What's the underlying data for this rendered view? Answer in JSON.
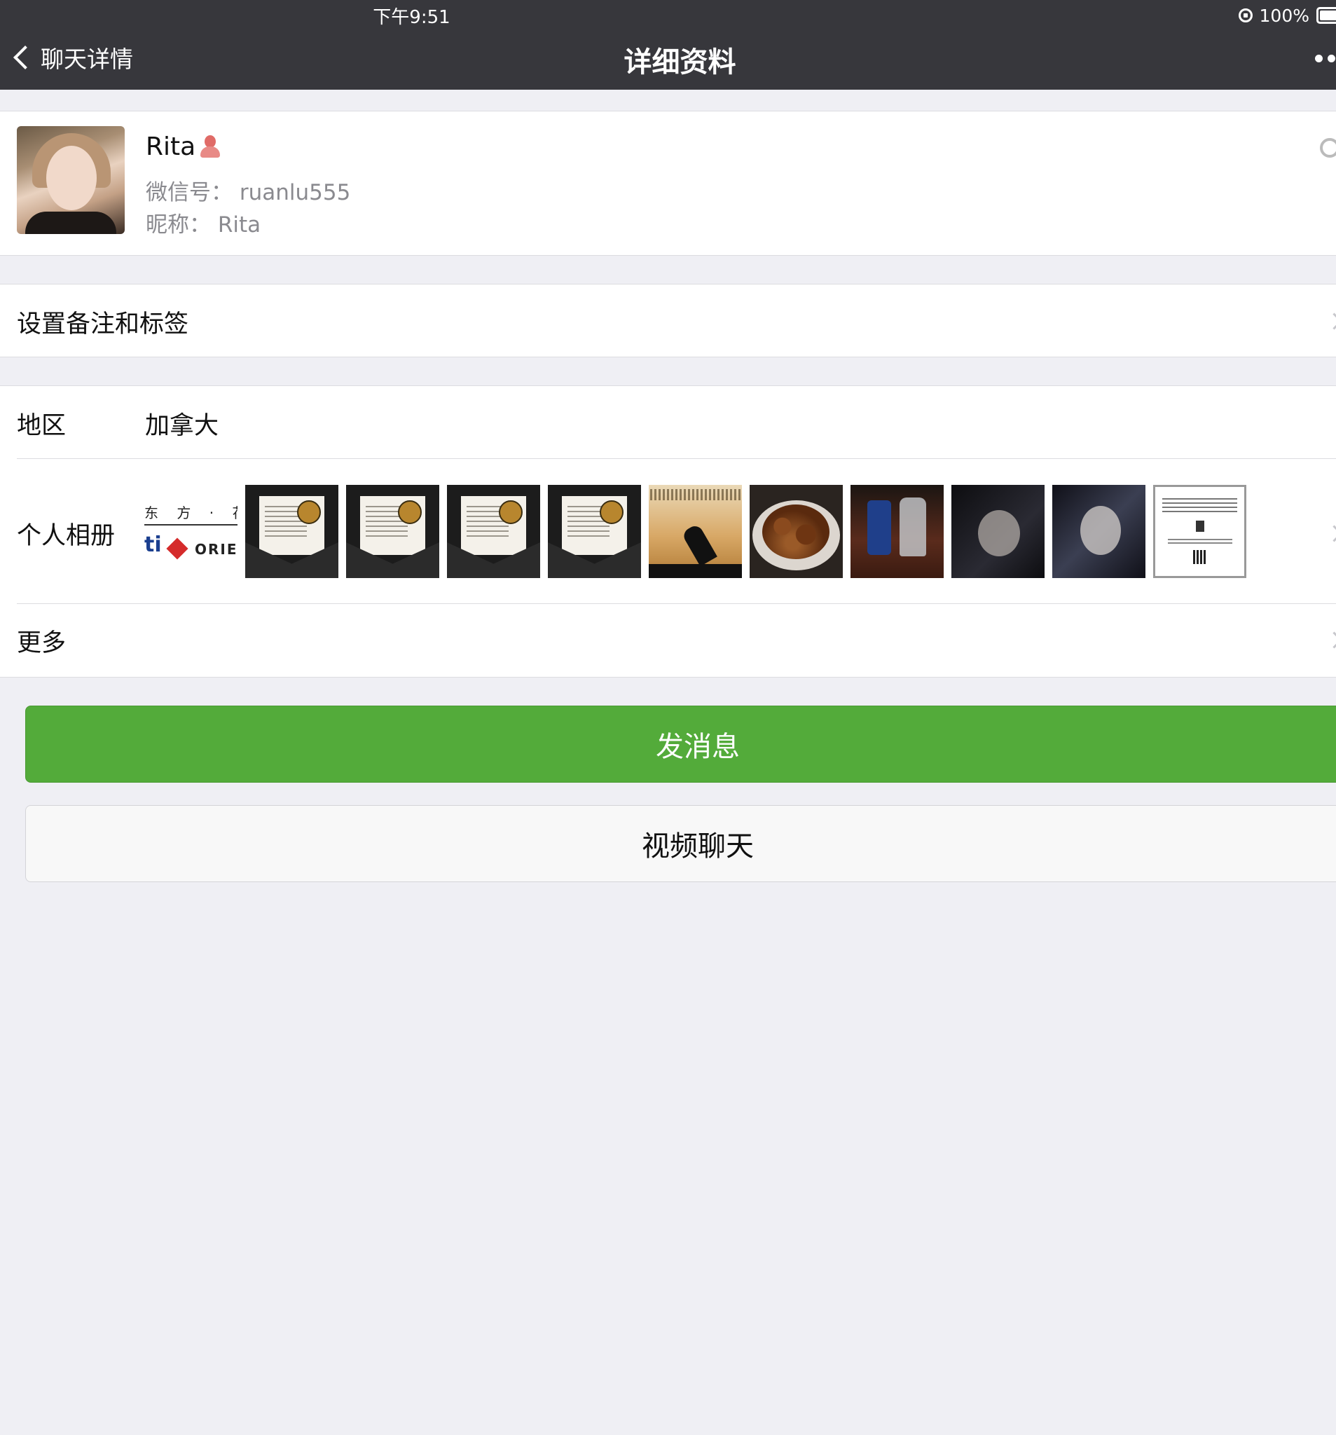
{
  "status_bar": {
    "time": "下午9:51",
    "battery": "100%"
  },
  "nav": {
    "back_label": "聊天详情",
    "title": "详细资料"
  },
  "profile": {
    "name": "Rita",
    "wechat_id": "微信号： ruanlu555",
    "nickname": "昵称： Rita"
  },
  "remark_row": {
    "label": "设置备注和标签"
  },
  "info": {
    "region_label": "地区",
    "region_value": "加拿大",
    "album_label": "个人相册",
    "album_logo": {
      "line1": "东 方 · 花 旗",
      "ti": "ti",
      "brand": "ORIEI"
    },
    "more_label": "更多"
  },
  "actions": {
    "message_label": "发消息",
    "video_label": "视频聊天"
  },
  "colors": {
    "nav_bg": "#37373c",
    "primary": "#53ab3a",
    "page_bg": "#efeff4"
  }
}
